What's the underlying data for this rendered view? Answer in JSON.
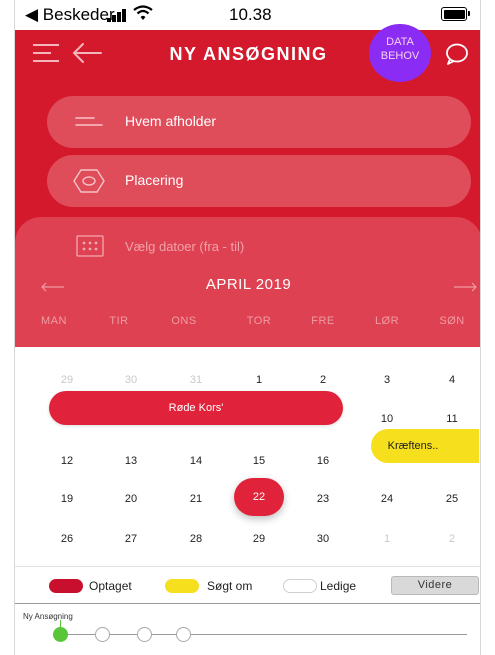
{
  "status_bar": {
    "back_label": "◀ Beskeder",
    "time": "10.38"
  },
  "header": {
    "title": "NY ANSØGNING",
    "badge_line1": "DATA",
    "badge_line2": "BEHOV"
  },
  "form": {
    "organizer_label": "Hvem afholder",
    "location_label": "Placering",
    "dates_label": "Vælg datoer (fra - til)"
  },
  "calendar": {
    "month": "APRIL 2019",
    "weekdays": [
      "MAN",
      "TIR",
      "ONS",
      "TOR",
      "FRE",
      "LØR",
      "SØN"
    ],
    "weeks": [
      [
        "29",
        "30",
        "31",
        "1",
        "2",
        "3",
        "4"
      ],
      [
        "",
        "",
        "",
        "",
        "",
        "10",
        "11"
      ],
      [
        "12",
        "13",
        "14",
        "15",
        "16",
        "",
        ""
      ],
      [
        "19",
        "20",
        "21",
        "22",
        "23",
        "24",
        "25"
      ],
      [
        "26",
        "27",
        "28",
        "29",
        "30",
        "1",
        "2"
      ]
    ],
    "events": {
      "red_event": "Røde Kors'",
      "yellow_event": "Kræftens.."
    },
    "today": "22"
  },
  "legend": {
    "occupied": "Optaget",
    "applied": "Søgt om",
    "available": "Ledige",
    "next_button": "Videre"
  },
  "colors": {
    "brand_red": "#d4192c",
    "event_red": "#e0233b",
    "event_yellow": "#f6df1d",
    "badge_purple": "#8b2cf5",
    "step_green": "#59c63a"
  },
  "stepper": {
    "label": "Ny Ansøgning",
    "total_steps": 4,
    "current_step": 1
  }
}
